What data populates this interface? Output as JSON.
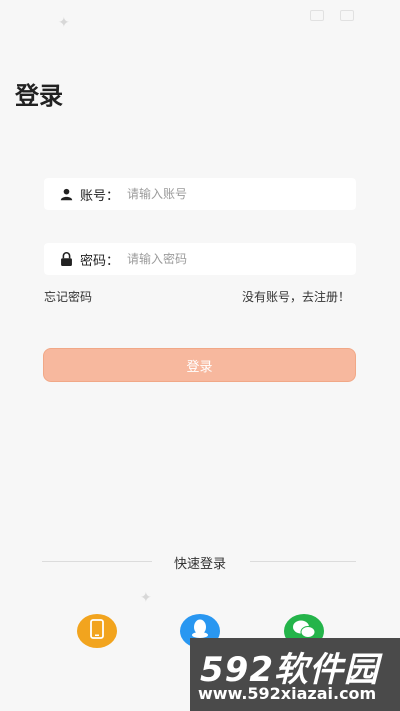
{
  "title": "登录",
  "username": {
    "label": "账号：",
    "placeholder": "请输入账号",
    "icon": "user-icon"
  },
  "password": {
    "label": "密码：",
    "placeholder": "请输入密码",
    "icon": "lock-icon"
  },
  "links": {
    "forgot": "忘记密码",
    "register": "没有账号，去注册！"
  },
  "login_button": "登录",
  "quick_login": {
    "label": "快速登录",
    "options": [
      {
        "name": "phone",
        "icon": "phone-icon",
        "color": "#f2a41e"
      },
      {
        "name": "qq",
        "icon": "qq-icon",
        "color": "#2997f1"
      },
      {
        "name": "wechat",
        "icon": "wechat-icon",
        "color": "#24b44a"
      }
    ]
  },
  "watermark": {
    "brand": "592软件园",
    "url": "www.592xiazai.com"
  },
  "colors": {
    "accent": "#f7b89e",
    "background": "#f7f7f7"
  }
}
